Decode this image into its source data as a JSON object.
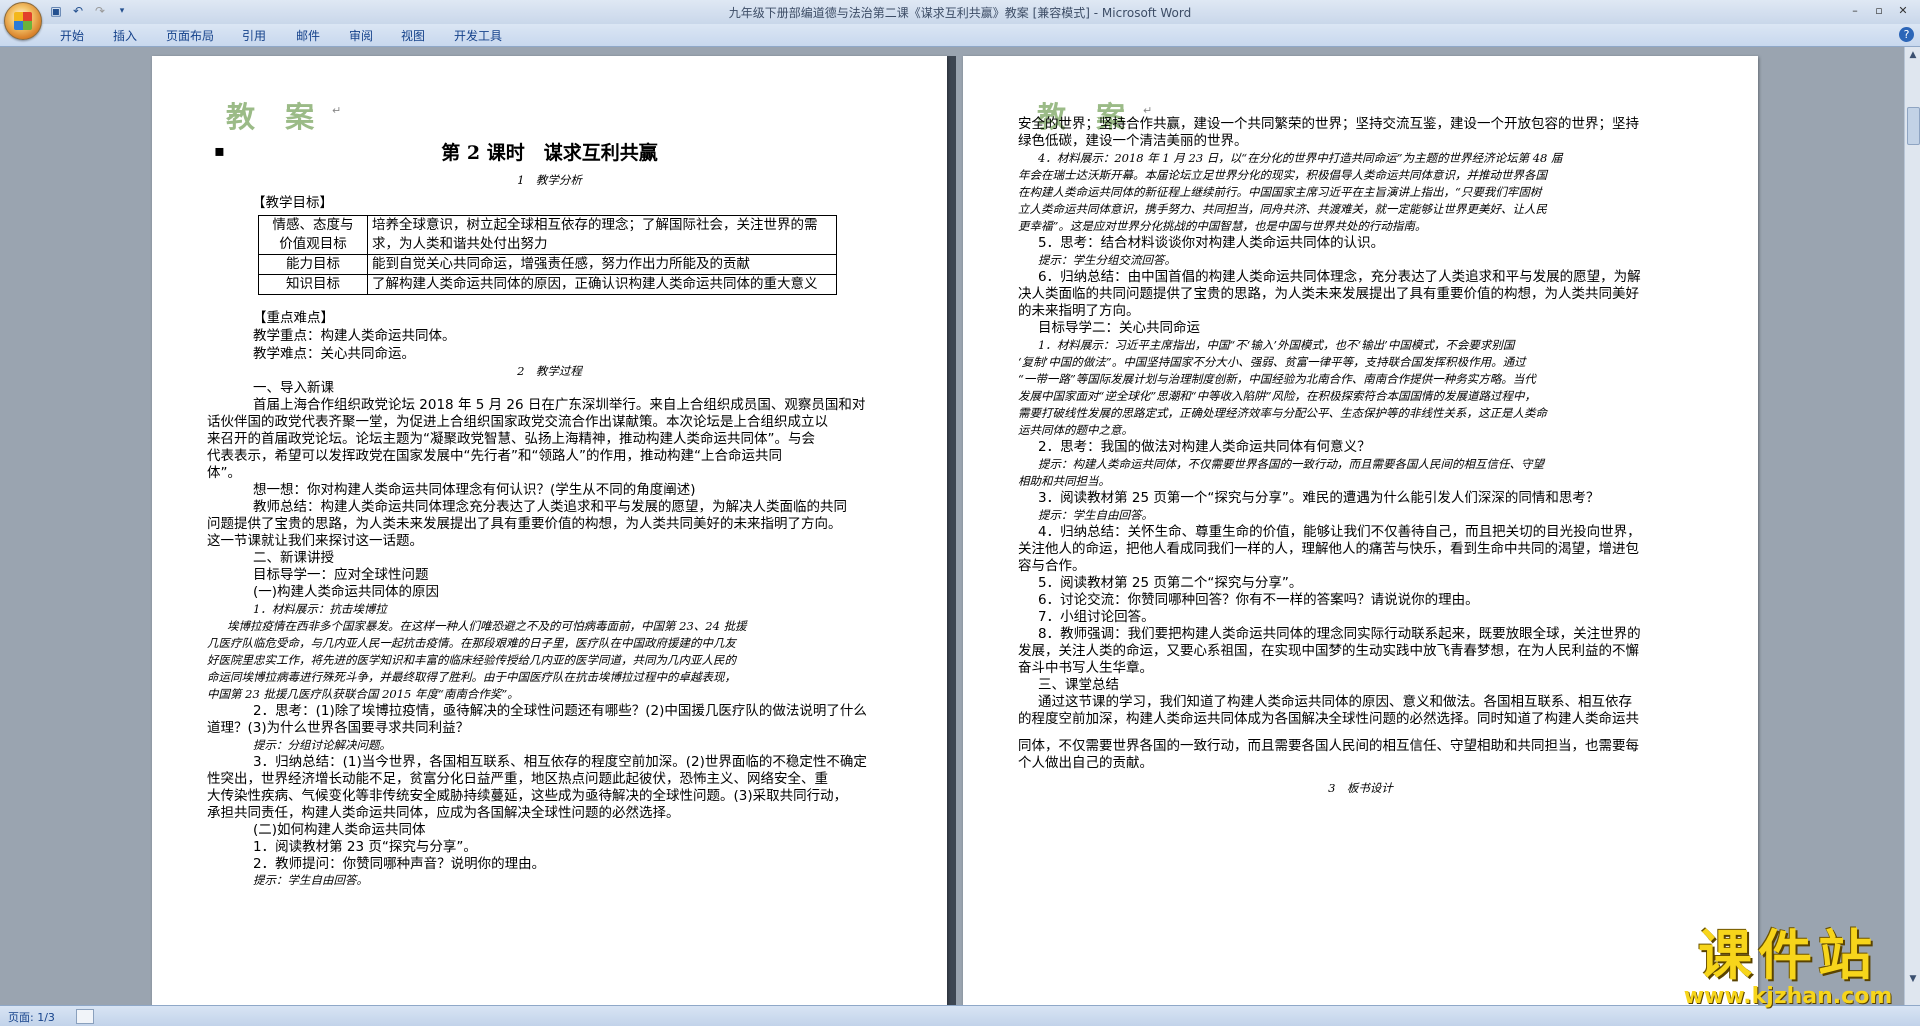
{
  "window": {
    "title": "九年级下册部编道德与法治第二课《谋求互利共赢》教案 [兼容模式] - Microsoft Word"
  },
  "menu": {
    "tabs": [
      "开始",
      "插入",
      "页面布局",
      "引用",
      "邮件",
      "审阅",
      "视图",
      "开发工具"
    ]
  },
  "status": {
    "page": "页面: 1/3"
  },
  "page1": {
    "header": "教 案",
    "title": "第 2 课时　谋求互利共赢",
    "section1": "1　教学分析",
    "obj_heading": "【教学目标】",
    "objectives": [
      {
        "label": "情感、态度与",
        "label2": "价值观目标",
        "text": "培养全球意识，树立起全球相互依存的理念；了解国际社会，关注世界的需",
        "text2": "求，为人类和谐共处付出努力"
      },
      {
        "label": "能力目标",
        "text": "能到自觉关心共同命运，增强责任感，努力作出力所能及的贡献"
      },
      {
        "label": "知识目标",
        "text": "了解构建人类命运共同体的原因，正确认识构建人类命运共同体的重大意义"
      }
    ],
    "lines": [
      "【重点难点】",
      "教学重点：构建人类命运共同体。",
      "教学难点：关心共同命运。",
      "2　教学过程",
      "一、导入新课",
      "首届上海合作组织政党论坛 2018 年 5 月 26 日在广东深圳举行。来自上合组织成员国、观察员国和对",
      "话伙伴国的政党代表齐聚一堂，为促进上合组织国家政党交流合作出谋献策。本次论坛是上合组织成立以",
      "来召开的首届政党论坛。论坛主题为“凝聚政党智慧、弘扬上海精神，推动构建人类命运共同体”。与会",
      "代表表示，希望可以发挥政党在国家发展中“先行者”和“领路人”的作用，推动构建“上合命运共同",
      "体”。",
      "想一想：你对构建人类命运共同体理念有何认识？(学生从不同的角度阐述)",
      "教师总结：构建人类命运共同体理念充分表达了人类追求和平与发展的愿望，为解决人类面临的共同",
      "问题提供了宝贵的思路，为人类未来发展提出了具有重要价值的构想，为人类共同美好的未来指明了方向。",
      "这一节课就让我们来探讨这一话题。",
      "二、新课讲授",
      "目标导学一：应对全球性问题",
      "(一)构建人类命运共同体的原因",
      "1．材料展示：抗击埃博拉",
      "埃博拉疫情在西非多个国家暴发。在这样一种人们唯恐避之不及的可怕病毒面前，中国第 23、24 批援",
      "几医疗队临危受命，与几内亚人民一起抗击疫情。在那段艰难的日子里，医疗队在中国政府援建的中几友",
      "好医院里忠实工作，将先进的医学知识和丰富的临床经验传授给几内亚的医学同道，共同为几内亚人民的",
      "命运同埃博拉病毒进行殊死斗争，并最终取得了胜利。由于中国医疗队在抗击埃博拉过程中的卓越表现，",
      "中国第 23 批援几医疗队获联合国 2015 年度“南南合作奖”。",
      "2．思考：(1)除了埃博拉疫情，亟待解决的全球性问题还有哪些？(2)中国援几医疗队的做法说明了什么",
      "道理？(3)为什么世界各国要寻求共同利益？",
      "提示：分组讨论解决问题。",
      "3．归纳总结：(1)当今世界，各国相互联系、相互依存的程度空前加深。(2)世界面临的不稳定性不确定",
      "性突出，世界经济增长动能不足，贫富分化日益严重，地区热点问题此起彼伏，恐怖主义、网络安全、重",
      "大传染性疾病、气候变化等非传统安全威胁持续蔓延，这些成为亟待解决的全球性问题。(3)采取共同行动，",
      "承担共同责任，构建人类命运共同体，应成为各国解决全球性问题的必然选择。",
      "(二)如何构建人类命运共同体",
      "1．阅读教材第 23 页“探究与分享”。",
      "2．教师提问：你赞同哪种声音？说明你的理由。",
      "提示：学生自由回答。"
    ]
  },
  "page2": {
    "header": "教 案",
    "lines": [
      "安全的世界；坚持合作共赢，建设一个共同繁荣的世界；坚持交流互鉴，建设一个开放包容的世界；坚持",
      "绿色低碳，建设一个清洁美丽的世界。",
      "4．材料展示：2018 年 1 月 23 日，以“在分化的世界中打造共同命运”为主题的世界经济论坛第 48 届",
      "年会在瑞士达沃斯开幕。本届论坛立足世界分化的现实，积极倡导人类命运共同体意识，并推动世界各国",
      "在构建人类命运共同体的新征程上继续前行。中国国家主席习近平在主旨演讲上指出，“只要我们牢固树",
      "立人类命运共同体意识，携手努力、共同担当，同舟共济、共渡难关，就一定能够让世界更美好、让人民",
      "更幸福”。这是应对世界分化挑战的中国智慧，也是中国与世界共处的行动指南。",
      "5．思考：结合材料谈谈你对构建人类命运共同体的认识。",
      "提示：学生分组交流回答。",
      "6．归纳总结：由中国首倡的构建人类命运共同体理念，充分表达了人类追求和平与发展的愿望，为解",
      "决人类面临的共同问题提供了宝贵的思路，为人类未来发展提出了具有重要价值的构想，为人类共同美好",
      "的未来指明了方向。",
      "目标导学二：关心共同命运",
      "1．材料展示：习近平主席指出，中国“不‘输入’外国模式，也不‘输出’中国模式，不会要求别国",
      "‘复制’中国的做法”。中国坚持国家不分大小、强弱、贫富一律平等，支持联合国发挥积极作用。通过",
      "“一带一路”等国际发展计划与治理制度创新，中国经验为北南合作、南南合作提供一种务实方略。当代",
      "发展中国家面对“逆全球化”思潮和“中等收入陷阱”风险，在积极探索符合本国国情的发展道路过程中，",
      "需要打破线性发展的思路定式，正确处理经济效率与分配公平、生态保护等的非线性关系，这正是人类命",
      "运共同体的题中之意。",
      "2．思考：我国的做法对构建人类命运共同体有何意义？",
      "提示：构建人类命运共同体，不仅需要世界各国的一致行动，而且需要各国人民间的相互信任、守望",
      "相助和共同担当。",
      "3．阅读教材第 25 页第一个“探究与分享”。难民的遭遇为什么能引发人们深深的同情和思考？",
      "提示：学生自由回答。",
      "4．归纳总结：关怀生命、尊重生命的价值，能够让我们不仅善待自己，而且把关切的目光投向世界，",
      "关注他人的命运，把他人看成同我们一样的人，理解他人的痛苦与快乐，看到生命中共同的渴望，增进包",
      "容与合作。",
      "5．阅读教材第 25 页第二个“探究与分享”。",
      "6．讨论交流：你赞同哪种回答？你有不一样的答案吗？请说说你的理由。",
      "7．小组讨论回答。",
      "8．教师强调：我们要把构建人类命运共同体的理念同实际行动联系起来，既要放眼全球，关注世界的",
      "发展，关注人类的命运，又要心系祖国，在实现中国梦的生动实践中放飞青春梦想，在为人民利益的不懈",
      "奋斗中书写人生华章。",
      "三、课堂总结",
      "通过这节课的学习，我们知道了构建人类命运共同体的原因、意义和做法。各国相互联系、相互依存",
      "的程度空前加深，构建人类命运共同体成为各国解决全球性问题的必然选择。同时知道了构建人类命运共",
      "同体，不仅需要世界各国的一致行动，而且需要各国人民间的相互信任、守望相助和共同担当，也需要每",
      "个人做出自己的贡献。",
      "3　板书设计"
    ]
  },
  "watermark": {
    "title": "课件站",
    "url": "www.kjzhan.com"
  }
}
